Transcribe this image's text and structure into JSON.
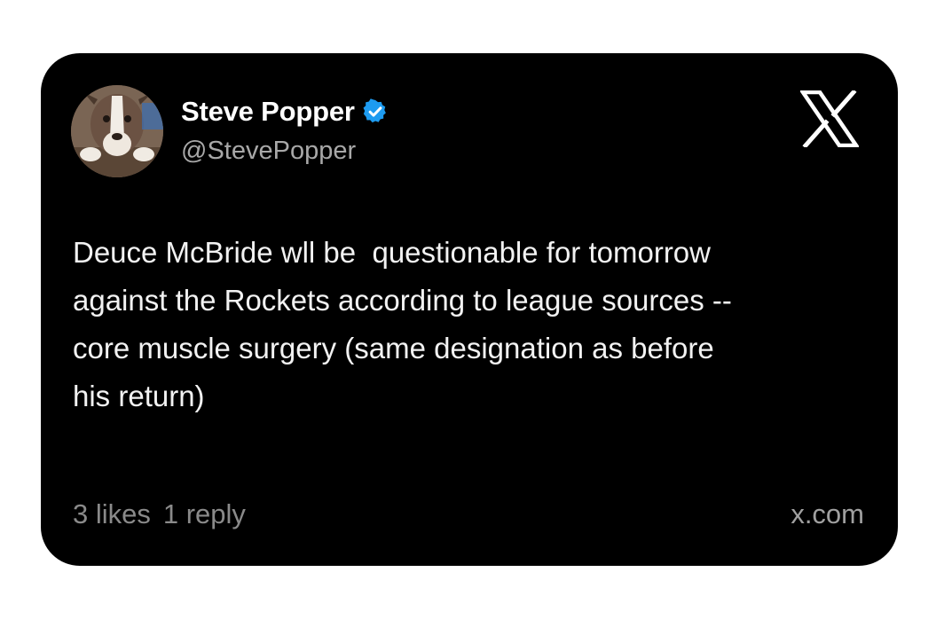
{
  "author": {
    "display_name": "Steve Popper",
    "handle": "@StevePopper",
    "verified": true,
    "verified_color": "#1d9bf0",
    "avatar_icon": "dog-avatar-icon"
  },
  "tweet": {
    "text": "Deuce McBride wll be  questionable for tomorrow\nagainst the Rockets according to league sources --\ncore muscle surgery (same designation as before\nhis return)"
  },
  "stats": {
    "likes": "3 likes",
    "replies": "1 reply"
  },
  "footer": {
    "domain": "x.com"
  },
  "brand": {
    "logo_icon": "x-logo-icon",
    "card_color": "#000000"
  }
}
